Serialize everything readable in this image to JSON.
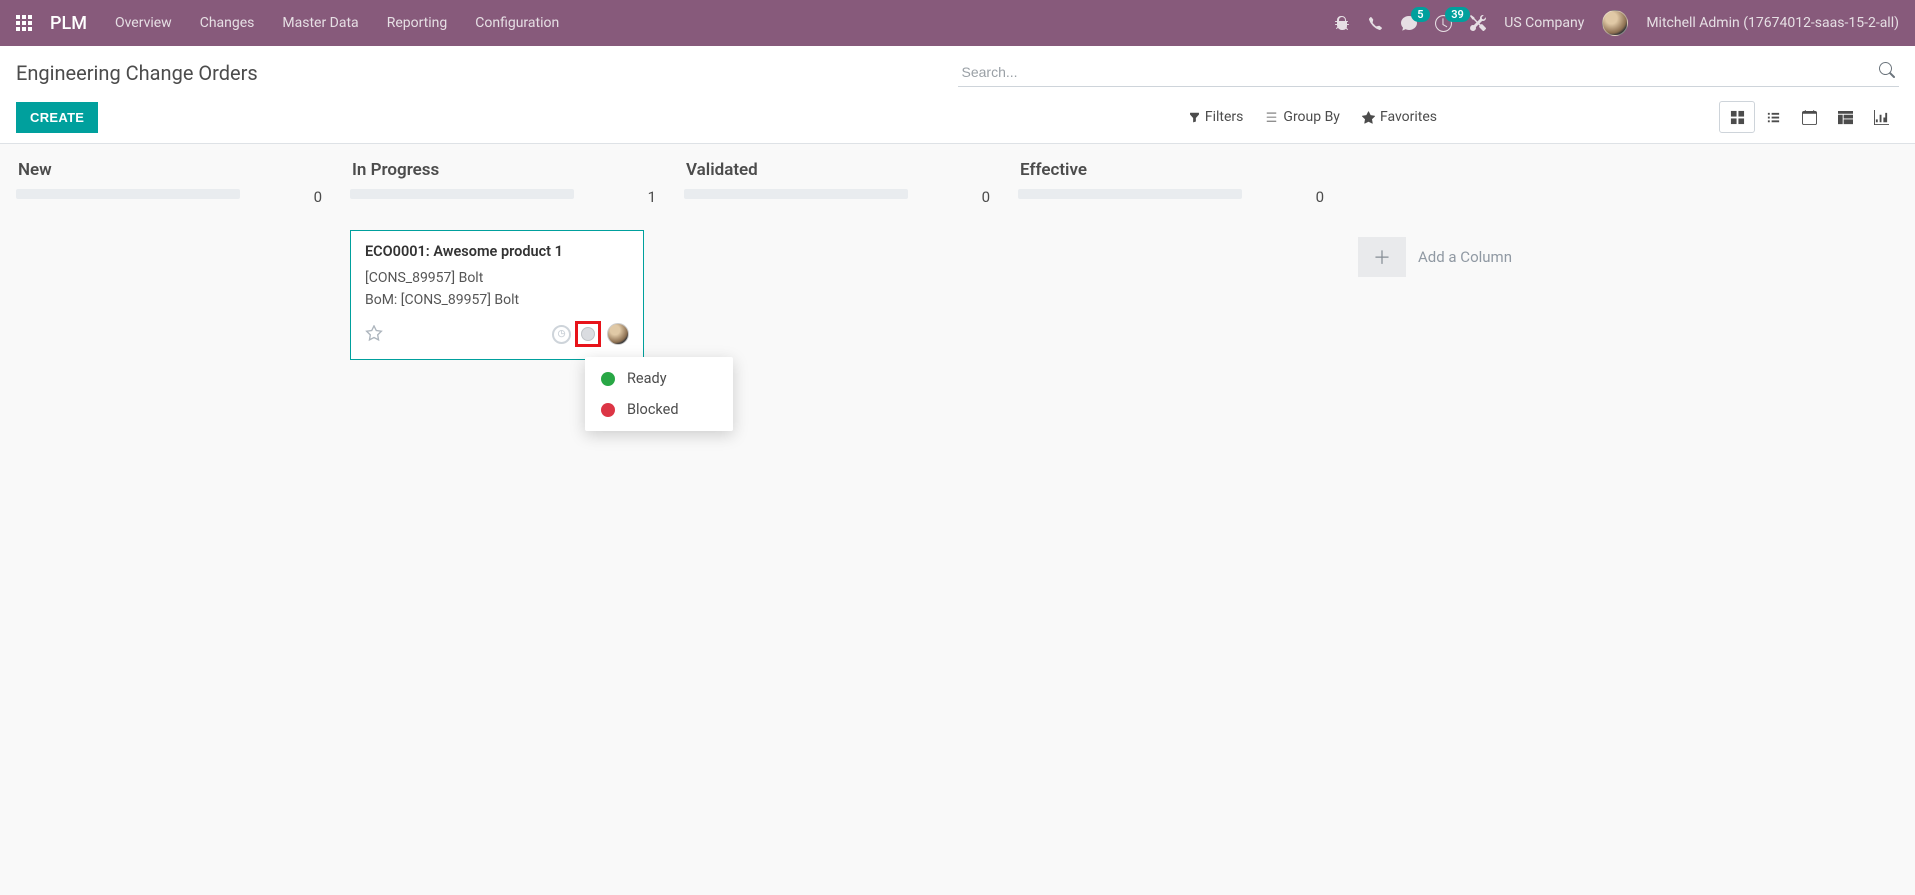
{
  "navbar": {
    "brand": "PLM",
    "menu": [
      "Overview",
      "Changes",
      "Master Data",
      "Reporting",
      "Configuration"
    ],
    "messages_count": "5",
    "activities_count": "39",
    "company": "US Company",
    "user": "Mitchell Admin (17674012-saas-15-2-all)"
  },
  "control_panel": {
    "breadcrumb": "Engineering Change Orders",
    "search_placeholder": "Search...",
    "create_label": "CREATE",
    "filters_label": "Filters",
    "groupby_label": "Group By",
    "favorites_label": "Favorites"
  },
  "kanban": {
    "columns": [
      {
        "title": "New",
        "count": "0"
      },
      {
        "title": "In Progress",
        "count": "1"
      },
      {
        "title": "Validated",
        "count": "0"
      },
      {
        "title": "Effective",
        "count": "0"
      }
    ],
    "add_column_label": "Add a Column",
    "card": {
      "title": "ECO0001: Awesome product 1",
      "product": "[CONS_89957] Bolt",
      "bom": "BoM: [CONS_89957] Bolt"
    },
    "status_menu": {
      "ready": "Ready",
      "blocked": "Blocked"
    }
  }
}
